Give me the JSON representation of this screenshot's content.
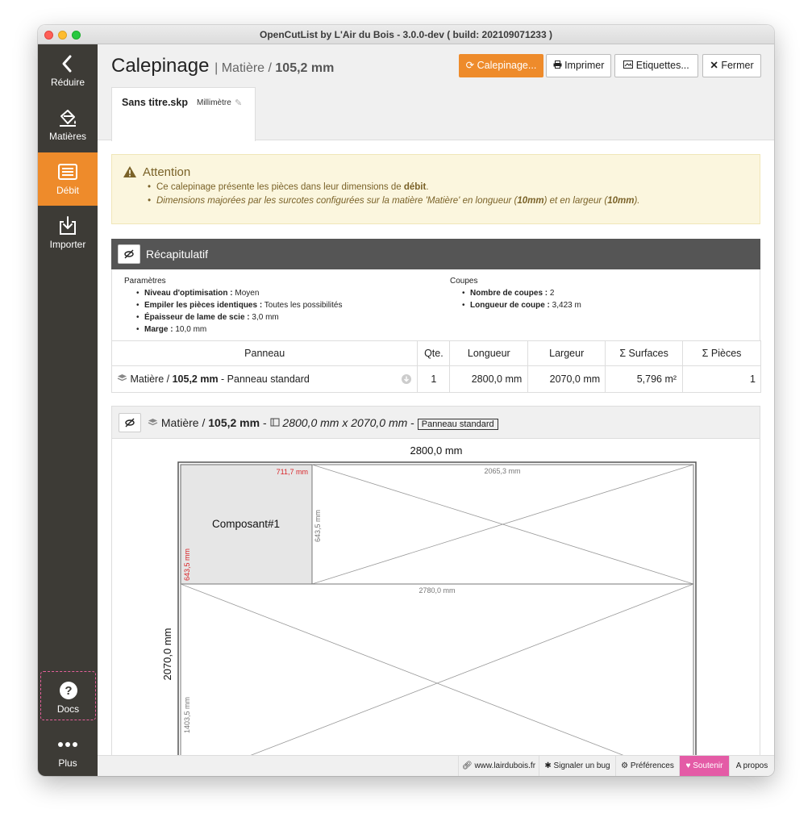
{
  "window": {
    "title": "OpenCutList by L'Air du Bois - 3.0.0-dev ( build: 202109071233 )"
  },
  "sidebar": {
    "items": [
      {
        "label": "Réduire",
        "icon": "chevron-left-icon"
      },
      {
        "label": "Matières",
        "icon": "paint-bucket-icon"
      },
      {
        "label": "Débit",
        "icon": "list-icon",
        "active": true
      },
      {
        "label": "Importer",
        "icon": "import-icon"
      },
      {
        "label": "Docs",
        "icon": "help-icon"
      },
      {
        "label": "Plus",
        "icon": "more-icon"
      }
    ]
  },
  "header": {
    "title": "Calepinage",
    "subtitle_prefix": "| Matière / ",
    "subtitle_value": "105,2 mm",
    "buttons": {
      "calepinage": "Calepinage...",
      "print": "Imprimer",
      "labels": "Etiquettes...",
      "close": "Fermer"
    },
    "tab": {
      "filename": "Sans titre.skp",
      "unit": "Millimètre"
    }
  },
  "alert": {
    "title": "Attention",
    "line1_a": "Ce calepinage présente les pièces dans leur dimensions de ",
    "line1_b": "débit",
    "line1_c": ".",
    "line2_a": "Dimensions majorées par les surcotes configurées sur la matière 'Matière' en longueur (",
    "line2_b": "10mm",
    "line2_c": ") et en largeur (",
    "line2_d": "10mm",
    "line2_e": ")."
  },
  "summary": {
    "title": "Récapitulatif",
    "params_heading": "Paramètres",
    "params": [
      {
        "k": "Niveau d'optimisation :",
        "v": " Moyen"
      },
      {
        "k": "Empiler les pièces identiques :",
        "v": " Toutes les possibilités"
      },
      {
        "k": "Épaisseur de lame de scie :",
        "v": " 3,0 mm"
      },
      {
        "k": "Marge :",
        "v": " 10,0 mm"
      }
    ],
    "cuts_heading": "Coupes",
    "cuts": [
      {
        "k": "Nombre de coupes :",
        "v": " 2"
      },
      {
        "k": "Longueur de coupe :",
        "v": " 3,423 m"
      }
    ],
    "columns": [
      "Panneau",
      "Qte.",
      "Longueur",
      "Largeur",
      "Σ Surfaces",
      "Σ Pièces"
    ],
    "row": {
      "material": "Matière / ",
      "thickness": "105,2 mm",
      "kind": " - Panneau standard",
      "qty": "1",
      "length": "2800,0 mm",
      "width": "2070,0 mm",
      "surface": "5,796 m²",
      "pieces": "1"
    }
  },
  "sheet": {
    "material": "Matière / ",
    "thickness": "105,2 mm",
    "sep": " - ",
    "dims": "2800,0 mm x 2070,0 mm",
    "sep2": " - ",
    "tag": "Panneau standard"
  },
  "diagram": {
    "top_length": "2800,0 mm",
    "left_width": "2070,0 mm",
    "part_label": "Composant#1",
    "part_length": "711,7 mm",
    "part_width": "643,5 mm",
    "offcut1_length": "2065,3 mm",
    "offcut1_width": "643,5 mm",
    "offcut2_length": "2780,0 mm",
    "offcut2_width": "1403,5 mm"
  },
  "footer": {
    "site": "www.lairdubois.fr",
    "bug": "Signaler un bug",
    "prefs": "Préférences",
    "support": "Soutenir",
    "about": "A propos"
  },
  "colors": {
    "accent": "#ee8b2b",
    "sidebar": "#3d3b36",
    "support": "#e45ba6",
    "part_dim": "#d9262a"
  }
}
